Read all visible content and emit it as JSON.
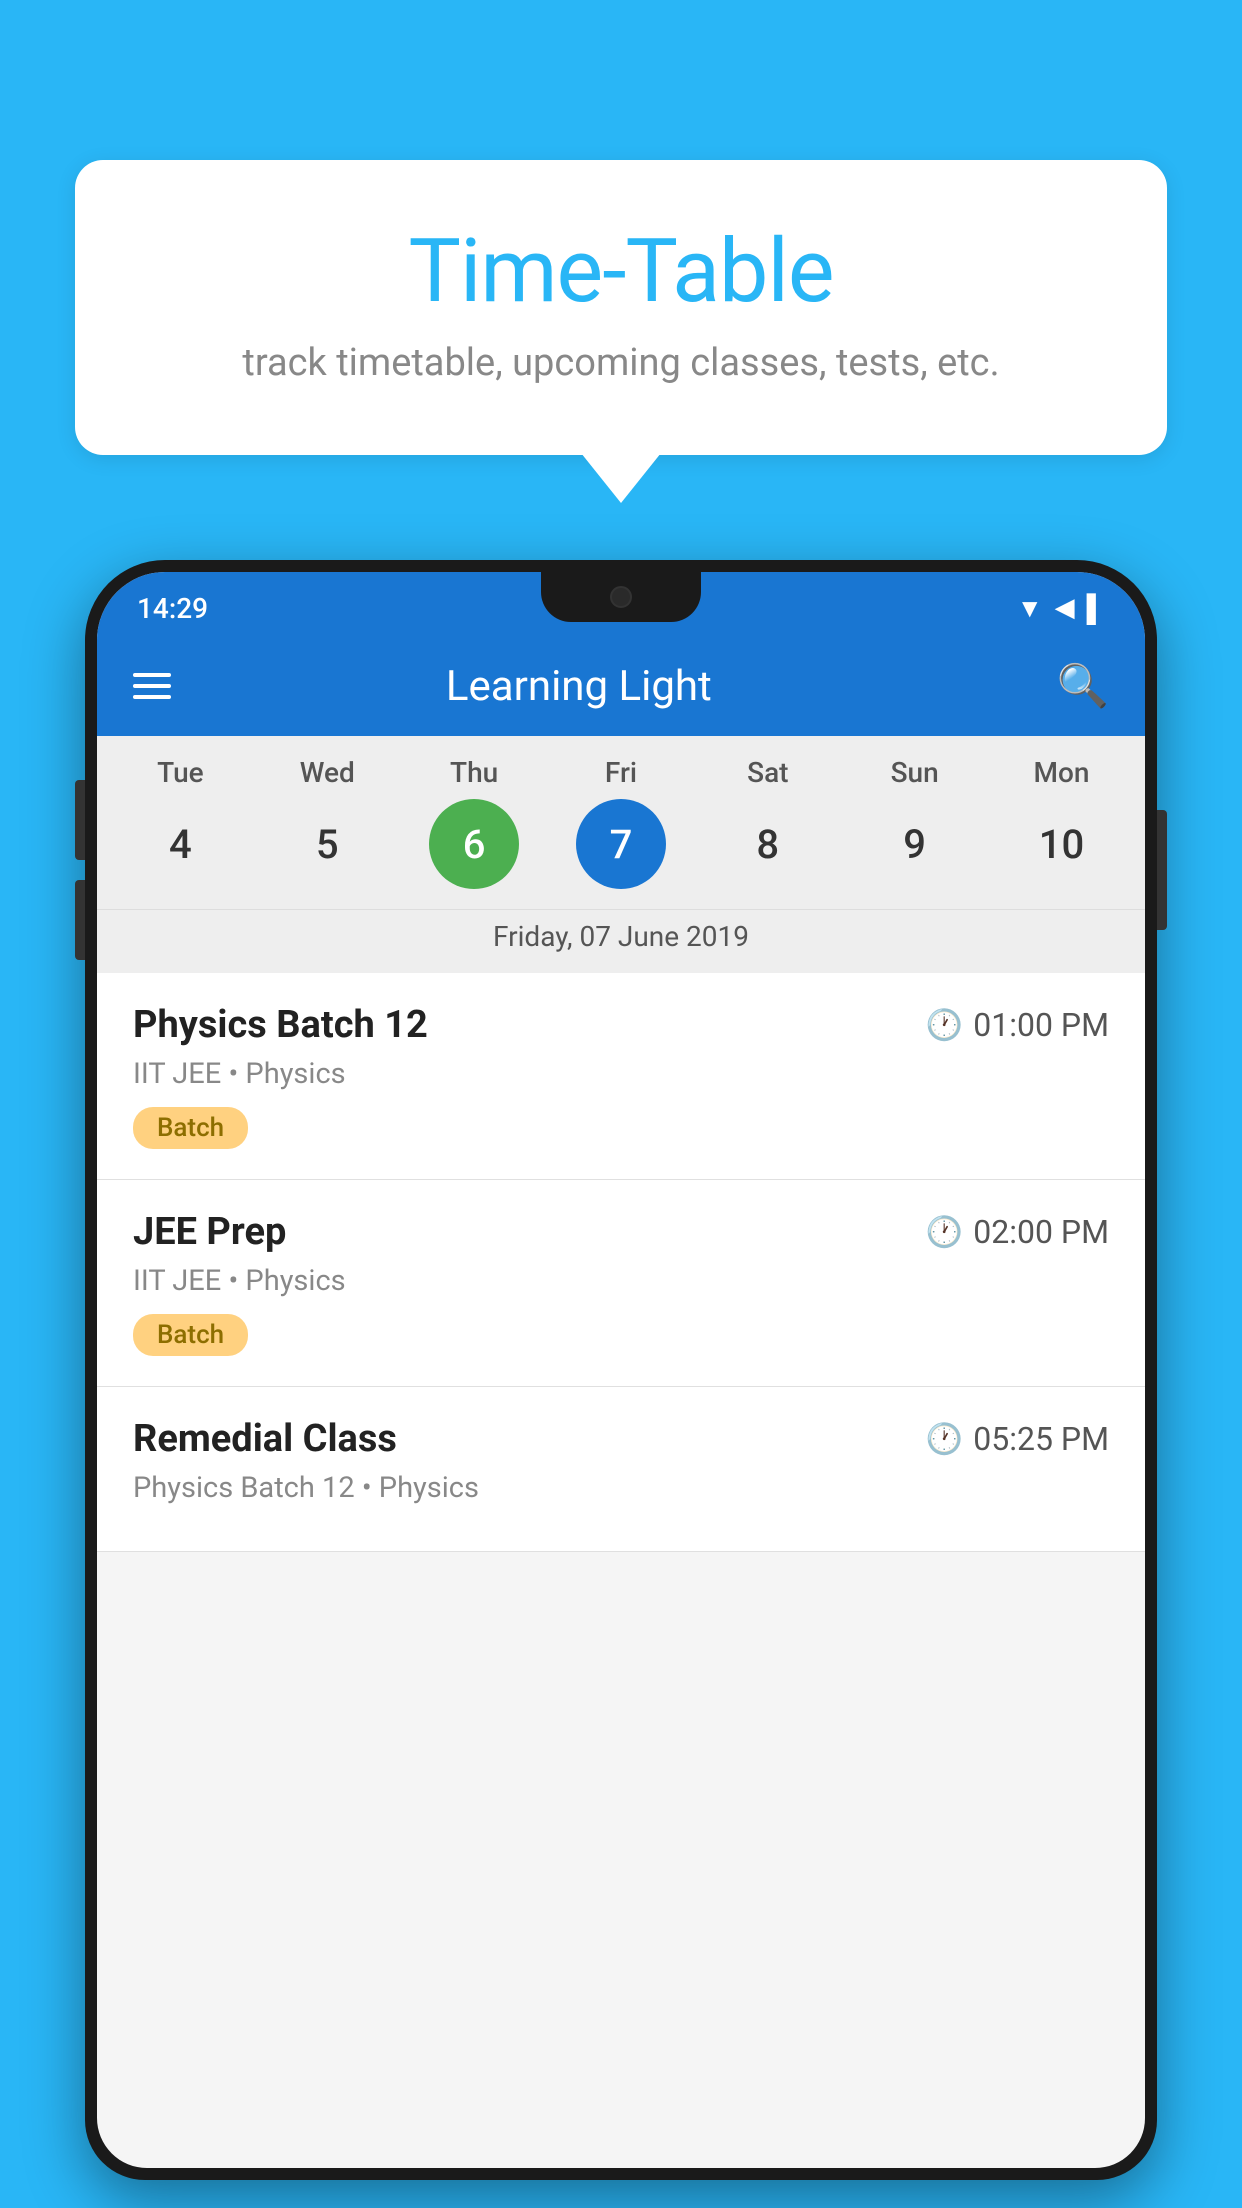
{
  "page": {
    "background_color": "#29b6f6"
  },
  "speech_bubble": {
    "title": "Time-Table",
    "subtitle": "track timetable, upcoming classes, tests, etc."
  },
  "status_bar": {
    "time": "14:29"
  },
  "toolbar": {
    "title": "Learning Light",
    "menu_icon": "hamburger-menu",
    "search_icon": "search"
  },
  "calendar": {
    "days": [
      {
        "label": "Tue",
        "number": "4"
      },
      {
        "label": "Wed",
        "number": "5"
      },
      {
        "label": "Thu",
        "number": "6",
        "state": "today"
      },
      {
        "label": "Fri",
        "number": "7",
        "state": "selected"
      },
      {
        "label": "Sat",
        "number": "8"
      },
      {
        "label": "Sun",
        "number": "9"
      },
      {
        "label": "Mon",
        "number": "10"
      }
    ],
    "selected_date_label": "Friday, 07 June 2019"
  },
  "schedule": {
    "items": [
      {
        "title": "Physics Batch 12",
        "time": "01:00 PM",
        "subtitle": "IIT JEE • Physics",
        "badge": "Batch"
      },
      {
        "title": "JEE Prep",
        "time": "02:00 PM",
        "subtitle": "IIT JEE • Physics",
        "badge": "Batch"
      },
      {
        "title": "Remedial Class",
        "time": "05:25 PM",
        "subtitle": "Physics Batch 12 • Physics",
        "badge": null
      }
    ]
  }
}
